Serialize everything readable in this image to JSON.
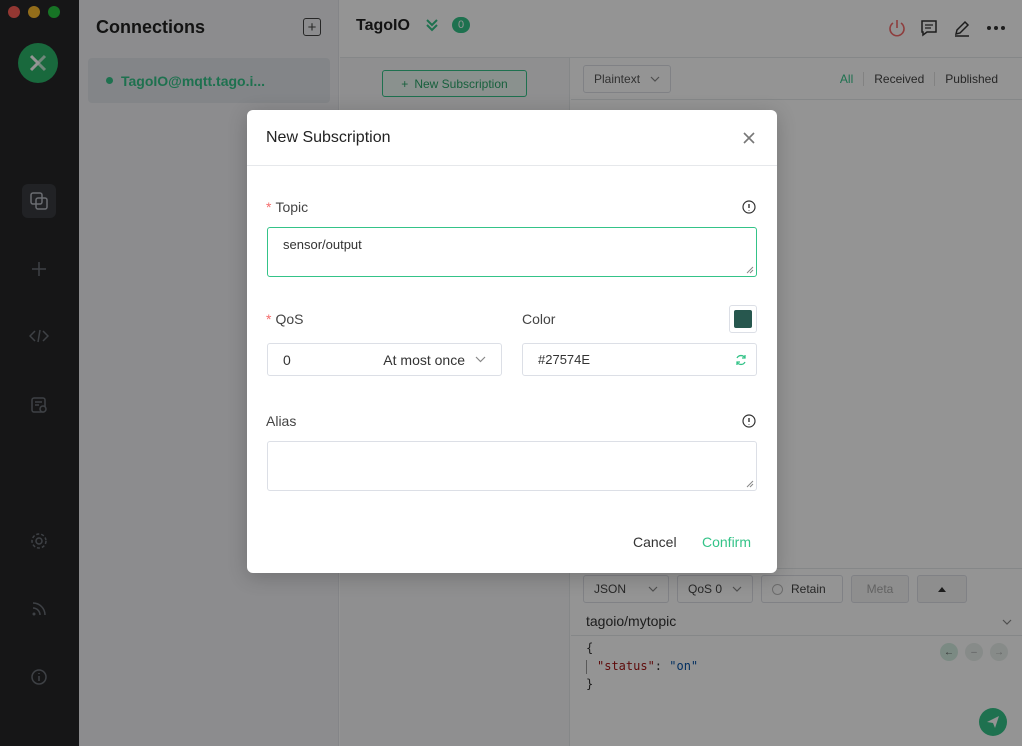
{
  "rail": {
    "items": [
      "connections-icon",
      "add-icon",
      "script-icon",
      "log-icon",
      "settings-icon",
      "subscribe-icon",
      "about-icon"
    ]
  },
  "connections": {
    "title": "Connections",
    "items": [
      {
        "name": "TagoIO@mqtt.tago.i...",
        "status": "connected"
      }
    ]
  },
  "header": {
    "title": "TagoIO",
    "badge_count": "0"
  },
  "subscriptions": {
    "new_button_label": "New Subscription"
  },
  "messages": {
    "format": "Plaintext",
    "filters": [
      "All",
      "Received",
      "Published"
    ],
    "active_filter": "All"
  },
  "publish": {
    "payload_type": "JSON",
    "qos": "QoS 0",
    "retain_label": "Retain",
    "meta_label": "Meta",
    "topic": "tagoio/mytopic",
    "code_open": "{",
    "code_key": "\"status\"",
    "code_colon": ": ",
    "code_value": "\"on\"",
    "code_close": "}"
  },
  "modal": {
    "title": "New Subscription",
    "topic_label": "Topic",
    "topic_value": "sensor/output",
    "qos_label": "QoS",
    "qos_value": "0",
    "qos_desc": "At most once",
    "color_label": "Color",
    "color_value": "#27574E",
    "alias_label": "Alias",
    "alias_value": "",
    "cancel_label": "Cancel",
    "confirm_label": "Confirm"
  },
  "colors": {
    "accent": "#34c388",
    "rail_bg": "#262729",
    "subscription_color": "#27574E"
  }
}
